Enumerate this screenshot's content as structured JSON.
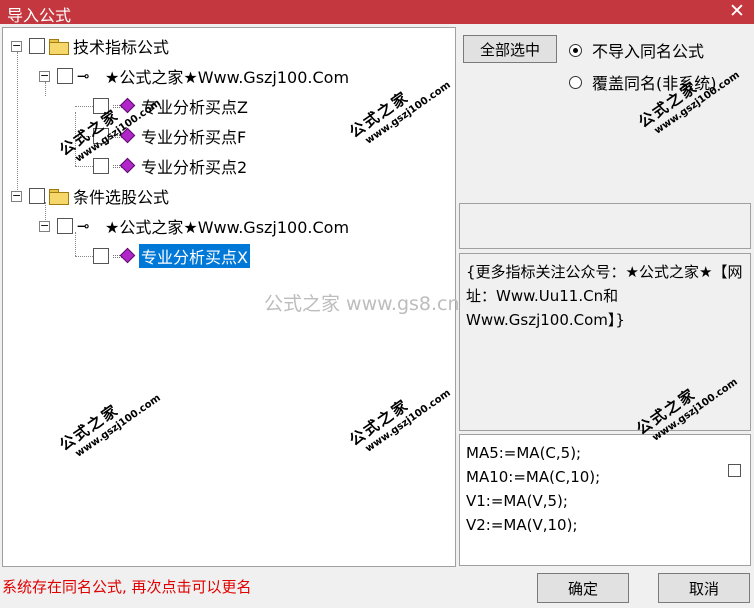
{
  "window": {
    "title": "导入公式",
    "close_glyph": "✕"
  },
  "tree": {
    "groups": [
      {
        "label": "技术指标公式",
        "expander": "−",
        "publisher": {
          "label": "★公式之家★Www.Gszj100.Com",
          "expander": "−",
          "items": [
            "专业分析买点Z",
            "专业分析买点F",
            "专业分析买点2"
          ]
        }
      },
      {
        "label": "条件选股公式",
        "expander": "−",
        "publisher": {
          "label": "★公式之家★Www.Gszj100.Com",
          "expander": "−",
          "items": [
            "专业分析买点X"
          ]
        }
      }
    ],
    "selected_item": "专业分析买点X"
  },
  "options": {
    "select_all_label": "全部选中",
    "radio_no_import": "不导入同名公式",
    "radio_overwrite": "覆盖同名(非系统)",
    "selected_radio": "no_import"
  },
  "description": {
    "text": "{更多指标关注公众号：★公式之家★【网址：Www.Uu11.Cn和Www.Gszj100.Com】}"
  },
  "code": {
    "lines": [
      "MA5:=MA(C,5);",
      "MA10:=MA(C,10);",
      "V1:=MA(V,5);",
      "V2:=MA(V,10);"
    ]
  },
  "footer": {
    "status": "系统存在同名公式, 再次点击可以更名",
    "ok_label": "确定",
    "cancel_label": "取消"
  },
  "watermark": {
    "center_text": "公式之家 www.gs8.cn",
    "stamp_text": "公式之家",
    "stamp_url": "www.gszj100.com"
  },
  "icons": {
    "folder": "folder-icon",
    "key": "key-icon",
    "formula": "formula-icon",
    "key_glyph": "⊸"
  },
  "colors": {
    "titlebar": "#c4373f",
    "selection": "#0078d7",
    "status_text": "#e00000"
  }
}
